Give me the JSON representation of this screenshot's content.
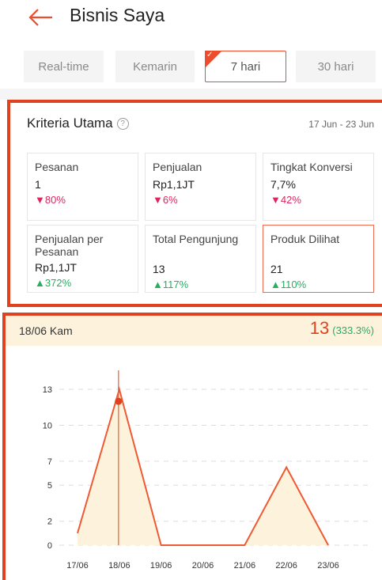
{
  "header": {
    "title": "Bisnis Saya"
  },
  "tabs": [
    {
      "label": "Real-time",
      "active": false
    },
    {
      "label": "Kemarin",
      "active": false
    },
    {
      "label": "7 hari",
      "active": true
    },
    {
      "label": "30 hari",
      "active": false
    }
  ],
  "section": {
    "title": "Kriteria Utama",
    "date_range": "17 Jun - 23 Jun"
  },
  "metrics": [
    {
      "label": "Pesanan",
      "value": "1",
      "change": "80%",
      "direction": "down"
    },
    {
      "label": "Penjualan",
      "value": "Rp1,1JT",
      "change": "6%",
      "direction": "down"
    },
    {
      "label": "Tingkat Konversi",
      "value": "7,7%",
      "change": "42%",
      "direction": "down"
    },
    {
      "label": "Penjualan per Pesanan",
      "value": "Rp1,1JT",
      "change": "372%",
      "direction": "up"
    },
    {
      "label": "Total Pengunjung",
      "value": "13",
      "change": "117%",
      "direction": "up"
    },
    {
      "label": "Produk Dilihat",
      "value": "21",
      "change": "110%",
      "direction": "up",
      "selected": true
    }
  ],
  "detail": {
    "day": "18/06 Kam",
    "value": "13",
    "percent": "(333.3%)"
  },
  "colors": {
    "accent": "#ee4d2d",
    "down": "#e0245e",
    "up": "#27ae60",
    "highlight_bg": "#fdf3dc"
  },
  "chart_data": {
    "type": "area",
    "categories": [
      "17/06",
      "18/06",
      "19/06",
      "20/06",
      "21/06",
      "22/06",
      "23/06"
    ],
    "values": [
      1,
      13,
      0,
      0,
      0,
      6.5,
      0
    ],
    "ytick_labels": [
      "0",
      "2",
      "5",
      "7",
      "10",
      "13"
    ],
    "ylim": [
      0,
      13
    ],
    "selected_index": 1,
    "selected_marker_value": 12,
    "grid": true
  }
}
